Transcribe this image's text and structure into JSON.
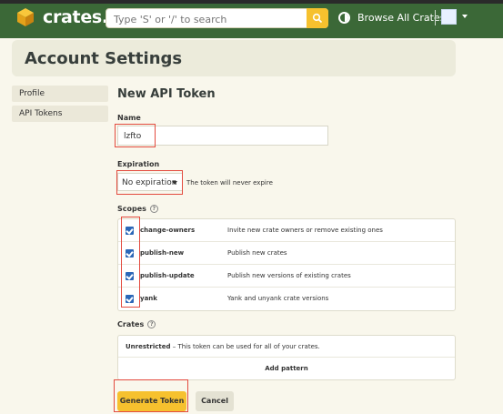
{
  "app": {
    "brand_name": "crates.io",
    "search_placeholder": "Type 'S' or '/' to search",
    "browse_all": "Browse All Crates",
    "accent": "#f6c12e",
    "topbar_color": "#3b6837"
  },
  "page": {
    "title": "Account Settings"
  },
  "sidebar": {
    "items": [
      {
        "label": "Profile"
      },
      {
        "label": "API Tokens"
      }
    ]
  },
  "form": {
    "heading": "New API Token",
    "name_label": "Name",
    "name_value": "lzfto",
    "expiration_label": "Expiration",
    "expiration_value": "No expiration",
    "expiration_note": "The token will never expire",
    "scopes_label": "Scopes",
    "scopes": [
      {
        "name": "change-owners",
        "description": "Invite new crate owners or remove existing ones",
        "checked": true
      },
      {
        "name": "publish-new",
        "description": "Publish new crates",
        "checked": true
      },
      {
        "name": "publish-update",
        "description": "Publish new versions of existing crates",
        "checked": true
      },
      {
        "name": "yank",
        "description": "Yank and unyank crate versions",
        "checked": true
      }
    ],
    "crates_label": "Crates",
    "crates_unrestricted_bold": "Unrestricted",
    "crates_unrestricted_text": " – This token can be used for all of your crates.",
    "add_pattern_label": "Add pattern",
    "generate_label": "Generate Token",
    "cancel_label": "Cancel"
  },
  "icons": {
    "logo": "crate-box-icon",
    "search": "search-icon",
    "theme": "theme-toggle-icon",
    "info": "info-circle-icon"
  }
}
